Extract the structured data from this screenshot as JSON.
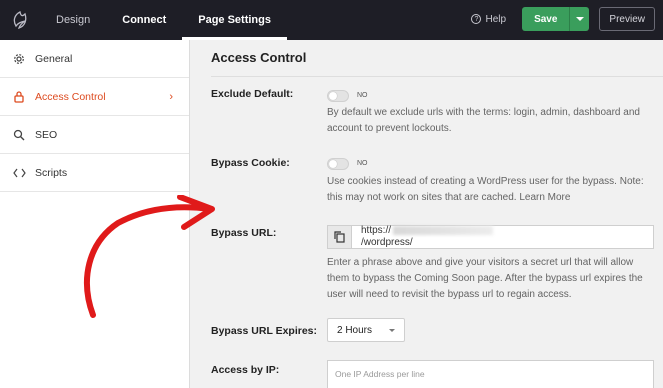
{
  "topbar": {
    "tabs": [
      "Design",
      "Connect",
      "Page Settings"
    ],
    "active_tab": "Page Settings",
    "help_label": "Help",
    "save_label": "Save",
    "preview_label": "Preview"
  },
  "sidebar": {
    "items": [
      {
        "label": "General",
        "icon": "gear-icon"
      },
      {
        "label": "Access Control",
        "icon": "lock-icon",
        "active": true
      },
      {
        "label": "SEO",
        "icon": "search-icon"
      },
      {
        "label": "Scripts",
        "icon": "code-icon"
      }
    ]
  },
  "main": {
    "title": "Access Control",
    "exclude_default": {
      "label": "Exclude Default:",
      "toggle_text": "NO",
      "description": "By default we exclude urls with the terms: login, admin, dashboard and account to prevent lockouts."
    },
    "bypass_cookie": {
      "label": "Bypass Cookie:",
      "toggle_text": "NO",
      "description": "Use cookies instead of creating a WordPress user for the bypass. Note: this may not work on sites that are cached. Learn More"
    },
    "bypass_url": {
      "label": "Bypass URL:",
      "url_prefix": "https://",
      "url_suffix": "/wordpress/",
      "description": "Enter a phrase above and give your visitors a secret url that will allow them to bypass the Coming Soon page. After the bypass url expires the user will need to revisit the bypass url to regain access."
    },
    "bypass_url_expires": {
      "label": "Bypass URL Expires:",
      "value": "2 Hours"
    },
    "access_by_ip": {
      "label": "Access by IP:",
      "placeholder": "One IP Address per line"
    }
  },
  "colors": {
    "topbar_bg": "#1e1e26",
    "save_green": "#3a9e5c",
    "active_orange": "#dd4a1f",
    "annotation_red": "#e01a1a"
  }
}
